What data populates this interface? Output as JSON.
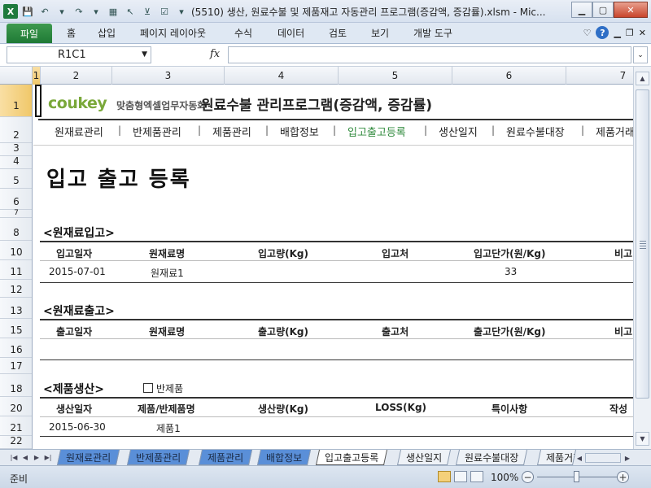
{
  "window": {
    "title": "(5510) 생산, 원료수불 및 제품재고 자동관리 프로그램(증감액, 증감률).xlsm  -  Mic...",
    "app_icon": "X"
  },
  "ribbon": {
    "file_tab": "파일",
    "tabs": [
      "홈",
      "삽입",
      "페이지 레이아웃",
      "수식",
      "데이터",
      "검토",
      "보기",
      "개발 도구"
    ]
  },
  "formula_bar": {
    "name_box": "R1C1",
    "fx_label": "fx",
    "formula": ""
  },
  "grid": {
    "columns": [
      "1",
      "2",
      "3",
      "4",
      "5",
      "6",
      "7"
    ],
    "rows": [
      "1",
      "2",
      "3",
      "4",
      "5",
      "6",
      "7",
      "8",
      "10",
      "11",
      "12",
      "13",
      "15",
      "16",
      "17",
      "18",
      "20",
      "21",
      "22"
    ]
  },
  "sheet": {
    "logo": "coukey",
    "logo_sub": "맞춤형엑셀업무자동화",
    "app_title": "원료수불 관리프로그램(증감액, 증감률)",
    "nav": [
      "원재료관리",
      "반제품관리",
      "제품관리",
      "배합정보",
      "입고출고등록",
      "생산일지",
      "원료수불대장",
      "제품거래"
    ],
    "active_nav": "입고출고등록",
    "page_heading": "입고 출고 등록",
    "sections": {
      "material_in": {
        "title": "<원재료입고>",
        "headers": [
          "입고일자",
          "원재료명",
          "입고량(Kg)",
          "입고처",
          "입고단가(원/Kg)",
          "비고"
        ],
        "rows": [
          [
            "2015-07-01",
            "원재료1",
            "",
            "",
            "33",
            ""
          ]
        ]
      },
      "material_out": {
        "title": "<원재료출고>",
        "headers": [
          "출고일자",
          "원재료명",
          "출고량(Kg)",
          "출고처",
          "출고단가(원/Kg)",
          "비고"
        ],
        "rows": []
      },
      "production": {
        "title": "<제품생산>",
        "checkbox_label": "반제품",
        "headers": [
          "생산일자",
          "제품/반제품명",
          "생산량(Kg)",
          "LOSS(Kg)",
          "특이사항",
          "작성"
        ],
        "rows": [
          [
            "2015-06-30",
            "제품1",
            "",
            "",
            "",
            ""
          ]
        ]
      }
    }
  },
  "sheet_tabs": [
    "원재료관리",
    "반제품관리",
    "제품관리",
    "배합정보",
    "입고출고등록",
    "생산일지",
    "원료수불대장",
    "제품거래"
  ],
  "active_sheet_tab": "입고출고등록",
  "status": {
    "ready": "준비",
    "zoom": "100%"
  },
  "colors": {
    "accent_green": "#2f8a3c",
    "file_tab": "#1f7a35",
    "colored_tab": "#5a8fd8"
  }
}
